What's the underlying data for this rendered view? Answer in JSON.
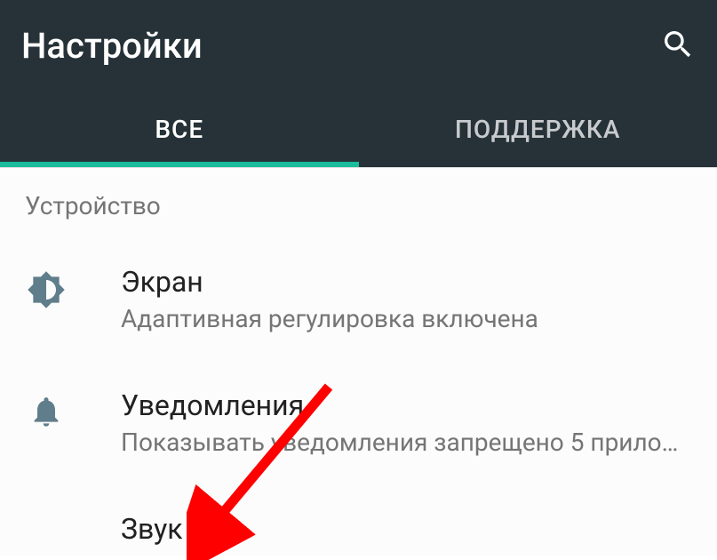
{
  "header": {
    "title": "Настройки"
  },
  "tabs": {
    "items": [
      {
        "label": "ВСЕ",
        "active": true
      },
      {
        "label": "ПОДДЕРЖКА",
        "active": false
      }
    ]
  },
  "section": {
    "device": "Устройство"
  },
  "settings": {
    "display": {
      "title": "Экран",
      "subtitle": "Адаптивная регулировка включена"
    },
    "notifications": {
      "title": "Уведомления",
      "subtitle": "Показывать уведомления запрещено 5 прило…"
    },
    "sound": {
      "title": "Звук"
    }
  },
  "colors": {
    "appbar": "#263238",
    "accent": "#1abc9c",
    "icon": "#607d8b",
    "annotation": "#ff0000"
  }
}
